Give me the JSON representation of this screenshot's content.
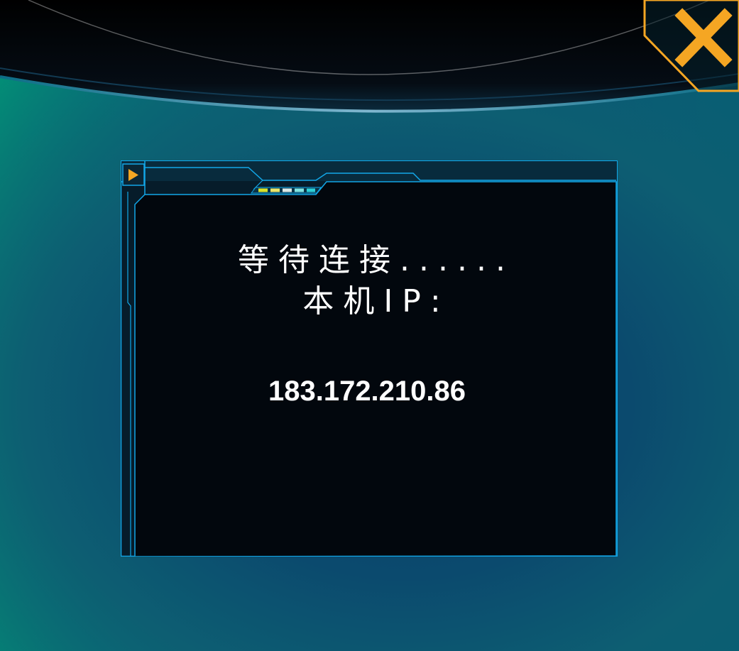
{
  "dialog": {
    "status_text": "等待连接......",
    "ip_label": "本机IP:",
    "ip_address": "183.172.210.86"
  },
  "icons": {
    "close": "close-icon",
    "arrow": "play-arrow-icon",
    "progress": "signal-bars-icon"
  },
  "colors": {
    "accent_orange": "#f5a623",
    "frame_cyan": "#12a7e8",
    "panel_bg": "#02070d",
    "bg_green": "#009a78",
    "bg_blue": "#054f78"
  }
}
